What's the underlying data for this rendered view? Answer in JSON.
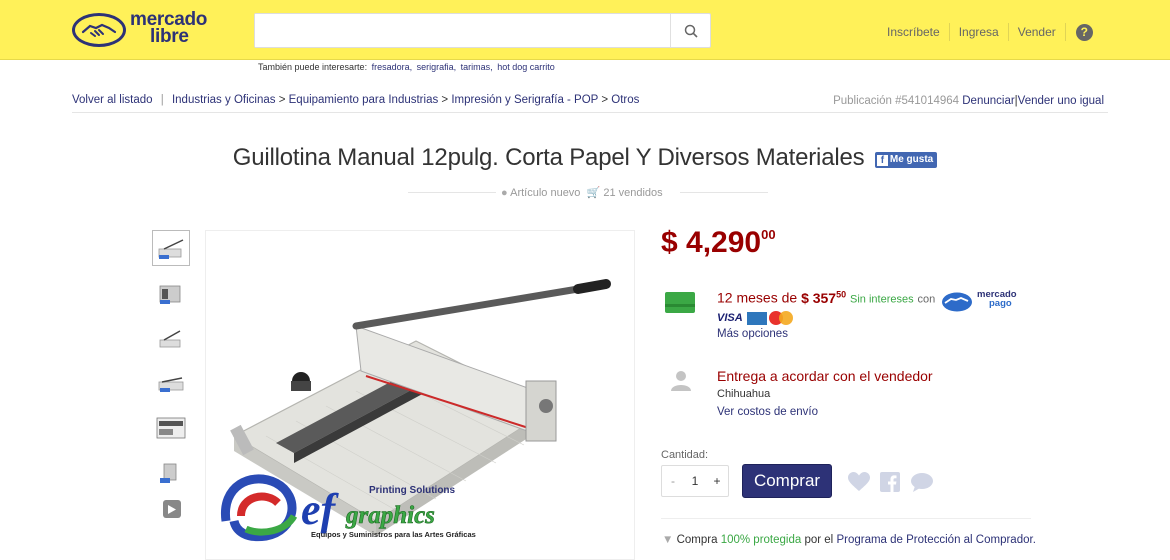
{
  "header": {
    "logo_line1": "mercado",
    "logo_line2": "libre",
    "search_placeholder": "",
    "links": [
      "Inscríbete",
      "Ingresa",
      "Vender"
    ],
    "help_label": "?"
  },
  "suggest": {
    "prefix": "También puede interesarte:",
    "items": [
      "fresadora,",
      "serigrafia,",
      "tarimas,",
      "hot dog carrito"
    ]
  },
  "breadcrumb": {
    "back": "Volver al listado",
    "path": [
      "Industrias y Oficinas",
      "Equipamiento para Industrias",
      "Impresión y Serigrafía - POP",
      "Otros"
    ],
    "publication": "Publicación #541014964",
    "report": "Denunciar",
    "sell_same": "Vender uno igual"
  },
  "product": {
    "title": "Guillotina Manual 12pulg. Corta Papel Y Diversos Materiales",
    "fb_like": "Me gusta",
    "condition": "Artículo nuevo",
    "sold": "21 vendidos",
    "price_main": "$ 4,290",
    "price_cents": "00",
    "installments_prefix": "12 meses de",
    "installment_amount": "$ 357",
    "installment_cents": "50",
    "interest_free": "Sin intereses",
    "with_label": "con",
    "mp_line1": "mercado",
    "mp_line2": "pago",
    "visa": "VISA",
    "more_options": "Más opciones",
    "shipping": "Entrega a acordar con el vendedor",
    "city": "Chihuahua",
    "shipping_costs": "Ver costos de envío",
    "quantity_label": "Cantidad:",
    "quantity_minus": "-",
    "quantity_value": "1",
    "quantity_plus": "+",
    "buy_label": "Comprar",
    "protect_prefix": "Compra",
    "protect_green": "100% protegida",
    "protect_mid": "por el",
    "protect_link": "Programa de Protección al Comprador."
  },
  "brand_image": {
    "tagline_top": "Printing Solutions",
    "word": "graphics",
    "tagline_bottom": "Equipos y Suministros para las Artes Gráficas"
  },
  "colors": {
    "header_bg": "#fff159",
    "brand_blue": "#2d3277",
    "price_red": "#990000",
    "green": "#3ba845"
  }
}
